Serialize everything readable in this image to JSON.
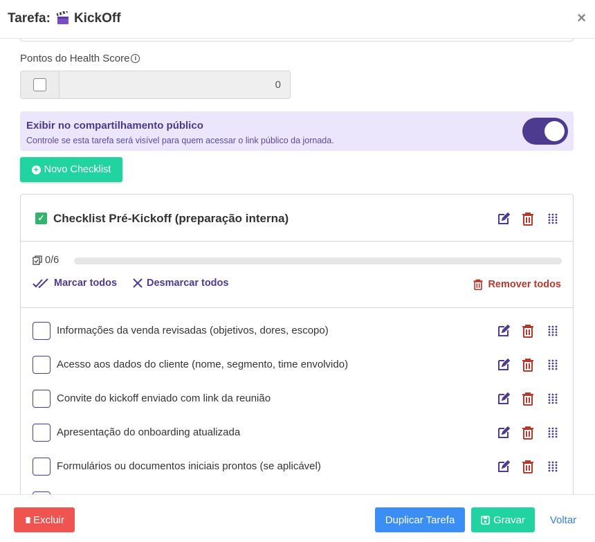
{
  "header": {
    "title_prefix": "Tarefa:",
    "title_emoji": "clapper-board-icon",
    "title_name": "KickOff",
    "close_label": "×"
  },
  "health_score": {
    "label": "Pontos do Health Score",
    "checked": false,
    "value": "0"
  },
  "public_share": {
    "title": "Exibir no compartilhamento público",
    "description": "Controle se esta tarefa será visível para quem acessar o link público da jornada.",
    "enabled": true
  },
  "new_checklist_button": "Novo Checklist",
  "checklist": {
    "title": "Checklist Pré-Kickoff (preparação interna)",
    "progress_text": "0/6",
    "progress_fraction": 0,
    "mark_all": "Marcar todos",
    "unmark_all": "Desmarcar todos",
    "remove_all": "Remover todos",
    "items": [
      {
        "label": "Informações da venda revisadas (objetivos, dores, escopo)",
        "checked": false
      },
      {
        "label": "Acesso aos dados do cliente (nome, segmento, time envolvido)",
        "checked": false
      },
      {
        "label": "Convite do kickoff enviado com link da reunião",
        "checked": false
      },
      {
        "label": "Apresentação do onboarding atualizada",
        "checked": false
      },
      {
        "label": "Formulários ou documentos iniciais prontos (se aplicável)",
        "checked": false
      }
    ]
  },
  "footer": {
    "delete": "Excluir",
    "duplicate": "Duplicar Tarefa",
    "save": "Gravar",
    "back": "Voltar"
  },
  "colors": {
    "primary_purple": "#4d3b8f",
    "danger_red": "#b33a2e",
    "green": "#21d3a1",
    "blue": "#3b8ef3",
    "delete_red": "#f05450",
    "public_bg": "#ebe6fb"
  }
}
